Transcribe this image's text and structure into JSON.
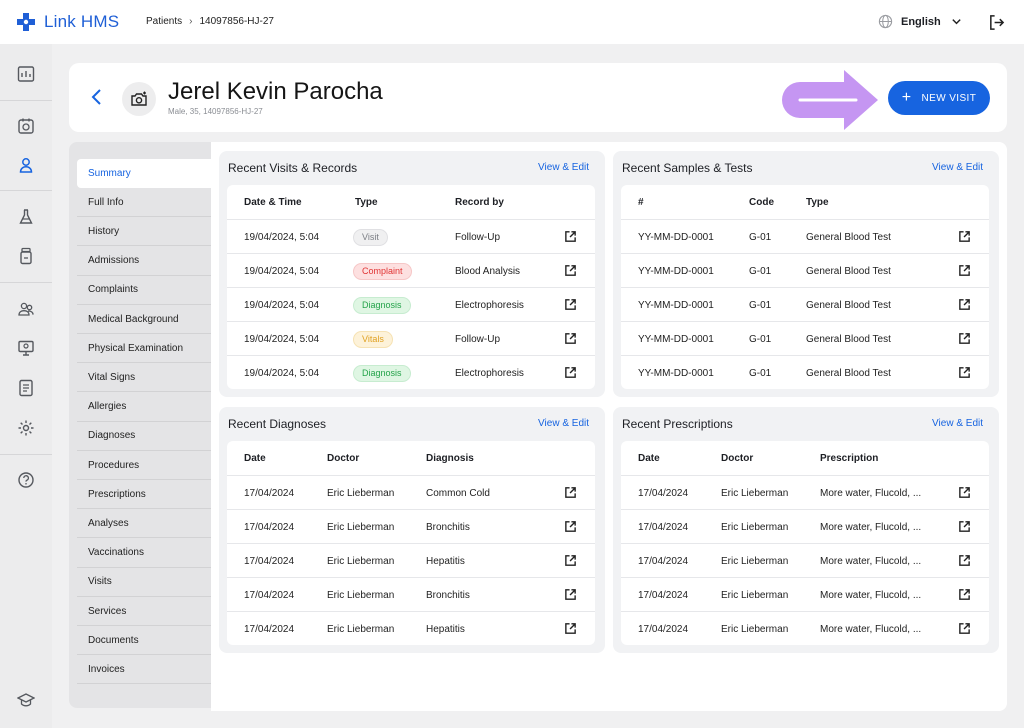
{
  "app": {
    "name": "Link HMS"
  },
  "breadcrumb": {
    "root": "Patients",
    "current": "14097856-HJ-27"
  },
  "language": {
    "selected": "English"
  },
  "patient": {
    "name": "Jerel Kevin Parocha",
    "meta": "Male, 35, 14097856-HJ-27"
  },
  "actions": {
    "new_visit": "NEW VISIT"
  },
  "nav": {
    "items": [
      "Summary",
      "Full Info",
      "History",
      "Admissions",
      "Complaints",
      "Medical Background",
      "Physical Examination",
      "Vital Signs",
      "Allergies",
      "Diagnoses",
      "Procedures",
      "Prescriptions",
      "Analyses",
      "Vaccinations",
      "Visits",
      "Services",
      "Documents",
      "Invoices"
    ],
    "active": "Summary"
  },
  "visits": {
    "title": "Recent Visits & Records",
    "link": "View & Edit",
    "headers": [
      "Date & Time",
      "Type",
      "Record by"
    ],
    "rows": [
      {
        "date": "19/04/2024, 5:04",
        "type": "Visit",
        "type_kind": "visit",
        "record": "Follow-Up"
      },
      {
        "date": "19/04/2024, 5:04",
        "type": "Complaint",
        "type_kind": "complaint",
        "record": "Blood Analysis"
      },
      {
        "date": "19/04/2024, 5:04",
        "type": "Diagnosis",
        "type_kind": "diagnosis",
        "record": "Electrophoresis"
      },
      {
        "date": "19/04/2024, 5:04",
        "type": "Vitals",
        "type_kind": "vitals",
        "record": "Follow-Up"
      },
      {
        "date": "19/04/2024, 5:04",
        "type": "Diagnosis",
        "type_kind": "diagnosis",
        "record": "Electrophoresis"
      }
    ]
  },
  "samples": {
    "title": "Recent Samples & Tests",
    "link": "View & Edit",
    "headers": [
      "#",
      "Code",
      "Type"
    ],
    "rows": [
      {
        "id": "YY-MM-DD-0001",
        "code": "G-01",
        "type": "General Blood Test"
      },
      {
        "id": "YY-MM-DD-0001",
        "code": "G-01",
        "type": "General Blood Test"
      },
      {
        "id": "YY-MM-DD-0001",
        "code": "G-01",
        "type": "General Blood Test"
      },
      {
        "id": "YY-MM-DD-0001",
        "code": "G-01",
        "type": "General Blood Test"
      },
      {
        "id": "YY-MM-DD-0001",
        "code": "G-01",
        "type": "General Blood Test"
      }
    ]
  },
  "diagnoses": {
    "title": "Recent Diagnoses",
    "link": "View & Edit",
    "headers": [
      "Date",
      "Doctor",
      "Diagnosis"
    ],
    "rows": [
      {
        "date": "17/04/2024",
        "doctor": "Eric Lieberman",
        "value": "Common Cold"
      },
      {
        "date": "17/04/2024",
        "doctor": "Eric Lieberman",
        "value": "Bronchitis"
      },
      {
        "date": "17/04/2024",
        "doctor": "Eric Lieberman",
        "value": "Hepatitis"
      },
      {
        "date": "17/04/2024",
        "doctor": "Eric Lieberman",
        "value": "Bronchitis"
      },
      {
        "date": "17/04/2024",
        "doctor": "Eric Lieberman",
        "value": "Hepatitis"
      }
    ]
  },
  "prescriptions": {
    "title": "Recent Prescriptions",
    "link": "View & Edit",
    "headers": [
      "Date",
      "Doctor",
      "Prescription"
    ],
    "rows": [
      {
        "date": "17/04/2024",
        "doctor": "Eric Lieberman",
        "value": "More water, Flucold, ..."
      },
      {
        "date": "17/04/2024",
        "doctor": "Eric Lieberman",
        "value": "More water, Flucold, ..."
      },
      {
        "date": "17/04/2024",
        "doctor": "Eric Lieberman",
        "value": "More water, Flucold, ..."
      },
      {
        "date": "17/04/2024",
        "doctor": "Eric Lieberman",
        "value": "More water, Flucold, ..."
      },
      {
        "date": "17/04/2024",
        "doctor": "Eric Lieberman",
        "value": "More water, Flucold, ..."
      }
    ]
  },
  "colors": {
    "accent": "#1764e0",
    "highlight_arrow": "#c596f2"
  }
}
